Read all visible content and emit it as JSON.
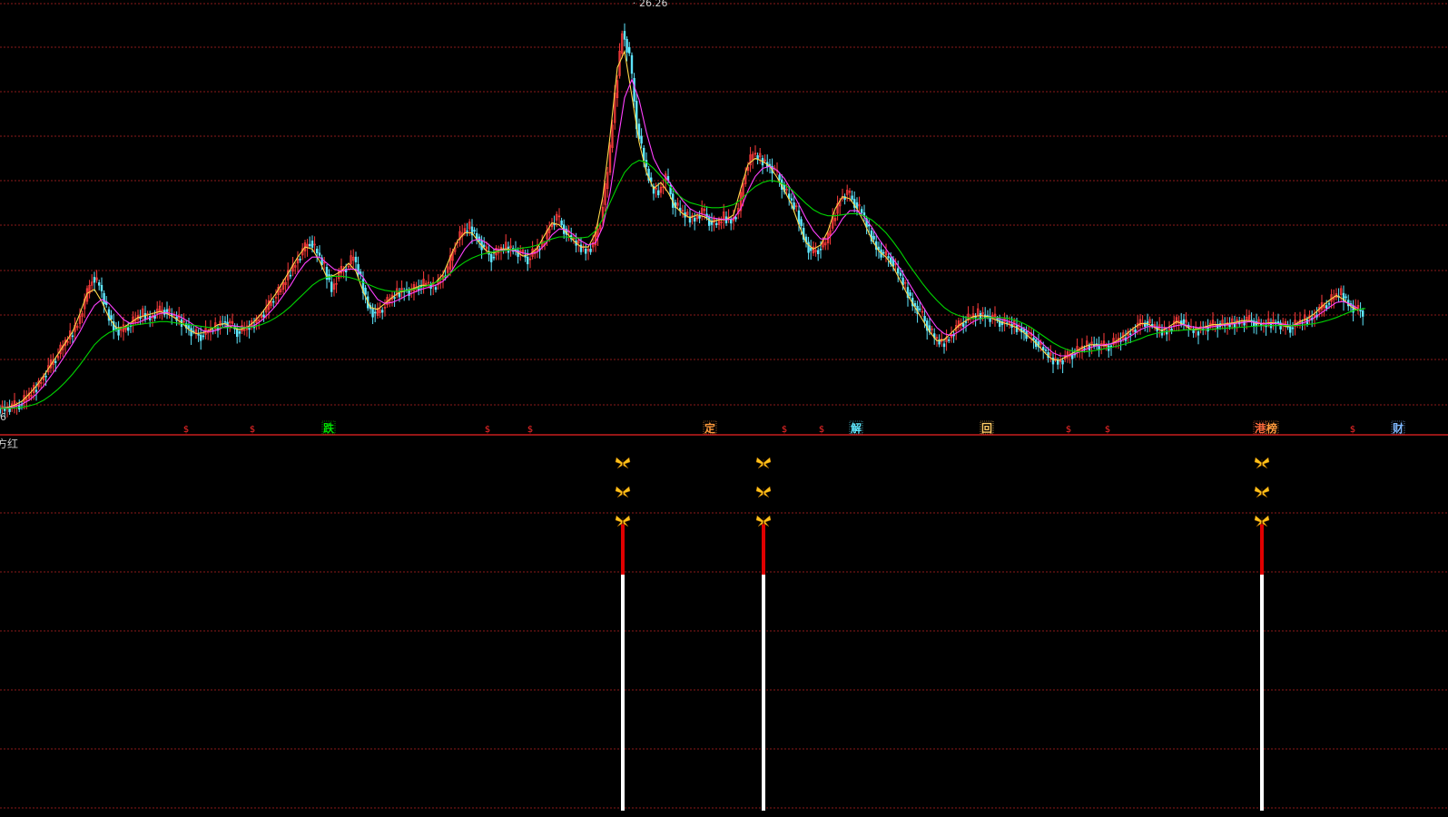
{
  "colors": {
    "background": "#000000",
    "grid": "#8b1a1a",
    "divider": "#c81e1e",
    "candle_up": "#ff3c3c",
    "candle_down": "#5fe8ff",
    "ma_fast": "#ffd84a",
    "ma_mid": "#ff40ff",
    "ma_slow": "#00d400",
    "label": "#d0d0d0",
    "bar_red": "#e00000",
    "bar_white": "#ffffff",
    "butterfly": "#ffc21a"
  },
  "main_panel": {
    "high_label": "26.26",
    "low_label": "6"
  },
  "events": [
    {
      "text": "$",
      "color": "#ff2a2a",
      "kind": "small"
    },
    {
      "text": "$",
      "color": "#ff2a2a",
      "kind": "small"
    },
    {
      "text": "跌",
      "color": "#00e000",
      "kind": "box"
    },
    {
      "text": "$",
      "color": "#ff2a2a",
      "kind": "small"
    },
    {
      "text": "$",
      "color": "#ff2a2a",
      "kind": "small"
    },
    {
      "text": "定",
      "color": "#ff9a3c",
      "kind": "box"
    },
    {
      "text": "$",
      "color": "#ff2a2a",
      "kind": "small"
    },
    {
      "text": "$",
      "color": "#ff2a2a",
      "kind": "small"
    },
    {
      "text": "解",
      "color": "#5fe8ff",
      "kind": "box"
    },
    {
      "text": "回",
      "color": "#ffcc66",
      "kind": "box"
    },
    {
      "text": "$",
      "color": "#ff2a2a",
      "kind": "small"
    },
    {
      "text": "$",
      "color": "#ff2a2a",
      "kind": "small"
    },
    {
      "text": "港",
      "color": "#ff6a3c",
      "kind": "box"
    },
    {
      "text": "榜",
      "color": "#ff9a3c",
      "kind": "box"
    },
    {
      "text": "$",
      "color": "#ff2a2a",
      "kind": "small"
    },
    {
      "text": "财",
      "color": "#7fb8ff",
      "kind": "box"
    }
  ],
  "indicator_panel": {
    "title": "方红",
    "signals": [
      {
        "id": "signal-1"
      },
      {
        "id": "signal-2"
      },
      {
        "id": "signal-3"
      }
    ]
  },
  "chart_data": {
    "type": "line",
    "title": "",
    "xlabel": "",
    "ylabel": "",
    "ylim": [
      6,
      26.26
    ],
    "grid": true,
    "x": [
      0,
      8,
      16,
      24,
      32,
      40,
      48,
      56,
      64,
      72,
      80,
      88,
      96,
      104,
      112,
      120,
      128,
      136,
      144,
      152,
      160,
      168,
      176,
      184,
      192,
      200,
      208,
      216,
      224,
      232,
      240,
      248,
      256,
      264,
      272,
      280,
      288,
      296,
      304,
      312,
      320,
      328,
      336,
      344,
      352,
      360,
      368,
      376,
      384,
      392,
      400,
      408,
      416,
      424,
      432,
      440,
      448,
      456,
      464,
      472,
      480,
      488,
      496,
      504,
      512,
      520,
      528,
      536,
      544,
      552,
      560,
      568,
      576,
      584,
      592,
      600,
      608,
      616,
      624,
      632,
      640,
      648,
      656,
      664,
      672,
      680,
      688,
      696,
      704,
      712,
      720,
      728,
      736,
      744,
      752,
      760,
      768,
      776,
      784,
      792,
      800,
      808,
      816,
      824,
      832,
      840,
      848,
      856,
      864,
      872,
      880,
      888,
      896,
      904,
      912,
      920,
      928,
      936,
      944,
      952,
      960,
      968,
      976,
      984,
      992,
      1000,
      1008,
      1016,
      1024,
      1032,
      1040,
      1048,
      1056,
      1064,
      1072,
      1080,
      1088,
      1096,
      1104,
      1112,
      1120,
      1128,
      1136,
      1144,
      1152,
      1160,
      1168,
      1176,
      1184,
      1192,
      1200,
      1208,
      1216,
      1224,
      1232,
      1240,
      1248,
      1256,
      1264,
      1272,
      1280,
      1288,
      1296,
      1304,
      1312,
      1320,
      1328,
      1336,
      1344,
      1352,
      1360,
      1368,
      1376,
      1384,
      1392,
      1400,
      1408,
      1416,
      1424,
      1432,
      1440,
      1448,
      1456,
      1464,
      1472,
      1480,
      1488,
      1496,
      1504,
      1512,
      1520,
      1528,
      1536,
      1544,
      1552,
      1560,
      1568
    ],
    "series": [
      {
        "values": [
          6.1,
          6.2,
          6.3,
          6.6,
          7.0,
          7.5,
          8.1,
          8.6,
          9.2,
          9.7,
          10.3,
          11.4,
          12.6,
          12.2,
          11.0,
          10.1,
          9.9,
          10.2,
          10.5,
          10.8,
          10.6,
          10.9,
          11.0,
          10.7,
          10.5,
          10.2,
          9.8,
          9.7,
          9.9,
          10.1,
          10.4,
          10.3,
          9.9,
          10.0,
          10.2,
          10.6,
          11.0,
          11.6,
          12.0,
          12.7,
          13.3,
          13.9,
          14.4,
          13.8,
          13.1,
          12.0,
          12.8,
          13.1,
          13.6,
          12.5,
          11.2,
          10.7,
          11.1,
          11.5,
          11.8,
          12.0,
          11.9,
          12.2,
          12.3,
          12.1,
          12.5,
          13.0,
          14.3,
          14.8,
          15.1,
          14.6,
          14.0,
          13.6,
          13.9,
          14.1,
          14.0,
          13.8,
          13.5,
          13.9,
          14.2,
          15.1,
          15.6,
          15.0,
          14.5,
          14.2,
          13.9,
          14.2,
          15.4,
          17.8,
          21.5,
          24.8,
          23.6,
          20.2,
          18.4,
          17.1,
          16.8,
          17.6,
          16.3,
          15.9,
          15.6,
          15.5,
          15.9,
          15.4,
          15.2,
          15.6,
          15.4,
          15.9,
          17.9,
          18.7,
          18.5,
          18.2,
          17.9,
          17.2,
          16.5,
          15.9,
          14.6,
          13.8,
          14.0,
          14.3,
          15.4,
          16.5,
          16.8,
          16.3,
          15.8,
          14.9,
          14.1,
          13.7,
          13.5,
          12.8,
          12.1,
          11.3,
          10.9,
          10.2,
          9.6,
          9.3,
          9.6,
          10.1,
          10.4,
          10.6,
          10.8,
          10.7,
          10.6,
          10.4,
          10.3,
          10.2,
          10.0,
          9.7,
          9.4,
          9.0,
          8.6,
          8.4,
          8.6,
          8.8,
          9.0,
          9.2,
          9.3,
          9.2,
          9.2,
          9.4,
          9.6,
          9.9,
          10.2,
          10.4,
          10.2,
          10.0,
          9.9,
          10.3,
          10.5,
          10.1,
          9.9,
          10.1,
          10.2,
          10.3,
          10.2,
          10.3,
          10.4,
          10.5,
          10.4,
          10.2,
          10.3,
          10.4,
          10.2,
          10.1,
          10.3,
          10.5,
          10.6,
          11.0,
          11.3,
          11.6,
          11.8,
          11.3,
          11.0,
          10.9
        ]
      },
      {
        "values": [
          6.1,
          6.15,
          6.25,
          6.45,
          6.8,
          7.2,
          7.7,
          8.25,
          8.8,
          9.35,
          9.9,
          10.8,
          11.8,
          12.0,
          11.4,
          10.6,
          10.1,
          10.1,
          10.35,
          10.6,
          10.7,
          10.8,
          10.9,
          10.8,
          10.6,
          10.35,
          10.0,
          9.8,
          9.85,
          10.0,
          10.25,
          10.3,
          10.1,
          10.0,
          10.1,
          10.4,
          10.8,
          11.3,
          11.8,
          12.4,
          13.0,
          13.6,
          14.1,
          14.0,
          13.4,
          12.6,
          12.7,
          12.9,
          13.3,
          12.9,
          11.9,
          11.1,
          11.0,
          11.3,
          11.6,
          11.85,
          11.95,
          12.05,
          12.2,
          12.2,
          12.35,
          12.75,
          13.6,
          14.4,
          14.8,
          14.8,
          14.3,
          13.9,
          13.8,
          14.0,
          14.0,
          13.9,
          13.65,
          13.75,
          14.05,
          14.7,
          15.3,
          15.2,
          14.8,
          14.4,
          14.1,
          14.1,
          14.8,
          16.6,
          19.6,
          23.0,
          23.8,
          21.6,
          19.3,
          17.8,
          17.0,
          17.3,
          16.8,
          16.1,
          15.75,
          15.55,
          15.7,
          15.6,
          15.35,
          15.45,
          15.45,
          15.7,
          17.0,
          18.2,
          18.5,
          18.35,
          18.1,
          17.55,
          16.9,
          16.2,
          15.2,
          14.3,
          14.0,
          14.2,
          14.9,
          16.0,
          16.6,
          16.5,
          16.0,
          15.3,
          14.5,
          13.9,
          13.6,
          13.1,
          12.4,
          11.7,
          11.1,
          10.5,
          9.9,
          9.45,
          9.5,
          9.85,
          10.2,
          10.45,
          10.65,
          10.7,
          10.65,
          10.5,
          10.35,
          10.25,
          10.1,
          9.85,
          9.55,
          9.2,
          8.8,
          8.5,
          8.5,
          8.7,
          8.9,
          9.1,
          9.25,
          9.25,
          9.2,
          9.3,
          9.5,
          9.75,
          10.05,
          10.3,
          10.3,
          10.1,
          9.95,
          10.15,
          10.4,
          10.25,
          10.0,
          10.05,
          10.15,
          10.25,
          10.25,
          10.3,
          10.35,
          10.45,
          10.45,
          10.3,
          10.3,
          10.35,
          10.3,
          10.15,
          10.2,
          10.4,
          10.55,
          10.8,
          11.15,
          11.45,
          11.7,
          11.5,
          11.15,
          10.95
        ]
      },
      {
        "values": [
          6.1,
          6.12,
          6.18,
          6.3,
          6.5,
          6.8,
          7.2,
          7.7,
          8.2,
          8.75,
          9.3,
          9.9,
          10.6,
          11.2,
          11.5,
          11.3,
          10.9,
          10.5,
          10.3,
          10.35,
          10.5,
          10.65,
          10.8,
          10.85,
          10.75,
          10.6,
          10.4,
          10.15,
          9.95,
          9.9,
          10.0,
          10.15,
          10.2,
          10.15,
          10.1,
          10.2,
          10.45,
          10.8,
          11.2,
          11.7,
          12.2,
          12.8,
          13.3,
          13.6,
          13.6,
          13.3,
          13.0,
          12.9,
          13.0,
          13.0,
          12.6,
          12.0,
          11.5,
          11.3,
          11.35,
          11.5,
          11.7,
          11.85,
          12.0,
          12.1,
          12.2,
          12.4,
          12.8,
          13.4,
          14.0,
          14.4,
          14.5,
          14.3,
          14.0,
          13.95,
          13.95,
          13.9,
          13.8,
          13.75,
          13.85,
          14.2,
          14.7,
          15.0,
          14.95,
          14.7,
          14.4,
          14.2,
          14.3,
          15.1,
          16.8,
          19.2,
          21.5,
          22.4,
          21.4,
          19.8,
          18.5,
          17.8,
          17.4,
          16.9,
          16.4,
          16.0,
          15.8,
          15.7,
          15.55,
          15.5,
          15.45,
          15.5,
          16.0,
          16.9,
          17.6,
          18.0,
          18.1,
          17.9,
          17.5,
          16.9,
          16.2,
          15.5,
          14.9,
          14.5,
          14.5,
          14.9,
          15.5,
          15.9,
          15.9,
          15.6,
          15.1,
          14.5,
          14.0,
          13.5,
          13.0,
          12.4,
          11.8,
          11.2,
          10.6,
          10.1,
          9.8,
          9.7,
          9.9,
          10.15,
          10.4,
          10.55,
          10.6,
          10.6,
          10.5,
          10.4,
          10.25,
          10.05,
          9.8,
          9.5,
          9.15,
          8.85,
          8.7,
          8.7,
          8.8,
          8.95,
          9.1,
          9.2,
          9.25,
          9.3,
          9.4,
          9.55,
          9.75,
          10.0,
          10.15,
          10.15,
          10.1,
          10.1,
          10.2,
          10.25,
          10.15,
          10.1,
          10.1,
          10.15,
          10.2,
          10.25,
          10.3,
          10.35,
          10.4,
          10.35,
          10.3,
          10.3,
          10.3,
          10.25,
          10.2,
          10.3,
          10.4,
          10.6,
          10.85,
          11.1,
          11.35,
          11.4,
          11.25,
          11.05
        ]
      },
      {
        "values": [
          6.1,
          6.1,
          6.12,
          6.15,
          6.22,
          6.32,
          6.5,
          6.75,
          7.05,
          7.4,
          7.8,
          8.25,
          8.75,
          9.25,
          9.6,
          9.85,
          10.0,
          10.1,
          10.2,
          10.25,
          10.3,
          10.35,
          10.4,
          10.4,
          10.35,
          10.3,
          10.25,
          10.2,
          10.15,
          10.1,
          10.1,
          10.1,
          10.1,
          10.1,
          10.1,
          10.15,
          10.25,
          10.4,
          10.6,
          10.85,
          11.15,
          11.5,
          11.85,
          12.2,
          12.45,
          12.6,
          12.65,
          12.65,
          12.6,
          12.5,
          12.35,
          12.2,
          12.05,
          11.95,
          11.9,
          11.9,
          11.95,
          12.0,
          12.1,
          12.2,
          12.35,
          12.55,
          12.8,
          13.1,
          13.35,
          13.55,
          13.7,
          13.8,
          13.85,
          13.9,
          13.95,
          14.0,
          14.05,
          14.1,
          14.2,
          14.35,
          14.5,
          14.6,
          14.6,
          14.55,
          14.55,
          14.6,
          14.9,
          15.5,
          16.3,
          17.1,
          17.8,
          18.2,
          18.4,
          18.3,
          18.0,
          17.6,
          17.2,
          16.8,
          16.5,
          16.3,
          16.2,
          16.1,
          16.05,
          16.05,
          16.1,
          16.2,
          16.45,
          16.8,
          17.1,
          17.3,
          17.4,
          17.35,
          17.2,
          16.95,
          16.6,
          16.25,
          15.95,
          15.75,
          15.65,
          15.65,
          15.7,
          15.75,
          15.75,
          15.65,
          15.45,
          15.15,
          14.8,
          14.35,
          13.85,
          13.3,
          12.8,
          12.3,
          11.85,
          11.45,
          11.1,
          10.85,
          10.7,
          10.6,
          10.55,
          10.55,
          10.6,
          10.6,
          10.6,
          10.55,
          10.45,
          10.3,
          10.1,
          9.85,
          9.6,
          9.35,
          9.15,
          9.0,
          8.92,
          8.9,
          8.92,
          8.98,
          9.05,
          9.12,
          9.2,
          9.3,
          9.42,
          9.55,
          9.7,
          9.8,
          9.88,
          9.92,
          9.95,
          9.98,
          10.0,
          10.0,
          10.0,
          10.02,
          10.05,
          10.08,
          10.1,
          10.12,
          10.15,
          10.18,
          10.2,
          10.2,
          10.2,
          10.2,
          10.2,
          10.22,
          10.25,
          10.3,
          10.38,
          10.48,
          10.6,
          10.75,
          10.9,
          11.0,
          11.05
        ]
      }
    ]
  }
}
